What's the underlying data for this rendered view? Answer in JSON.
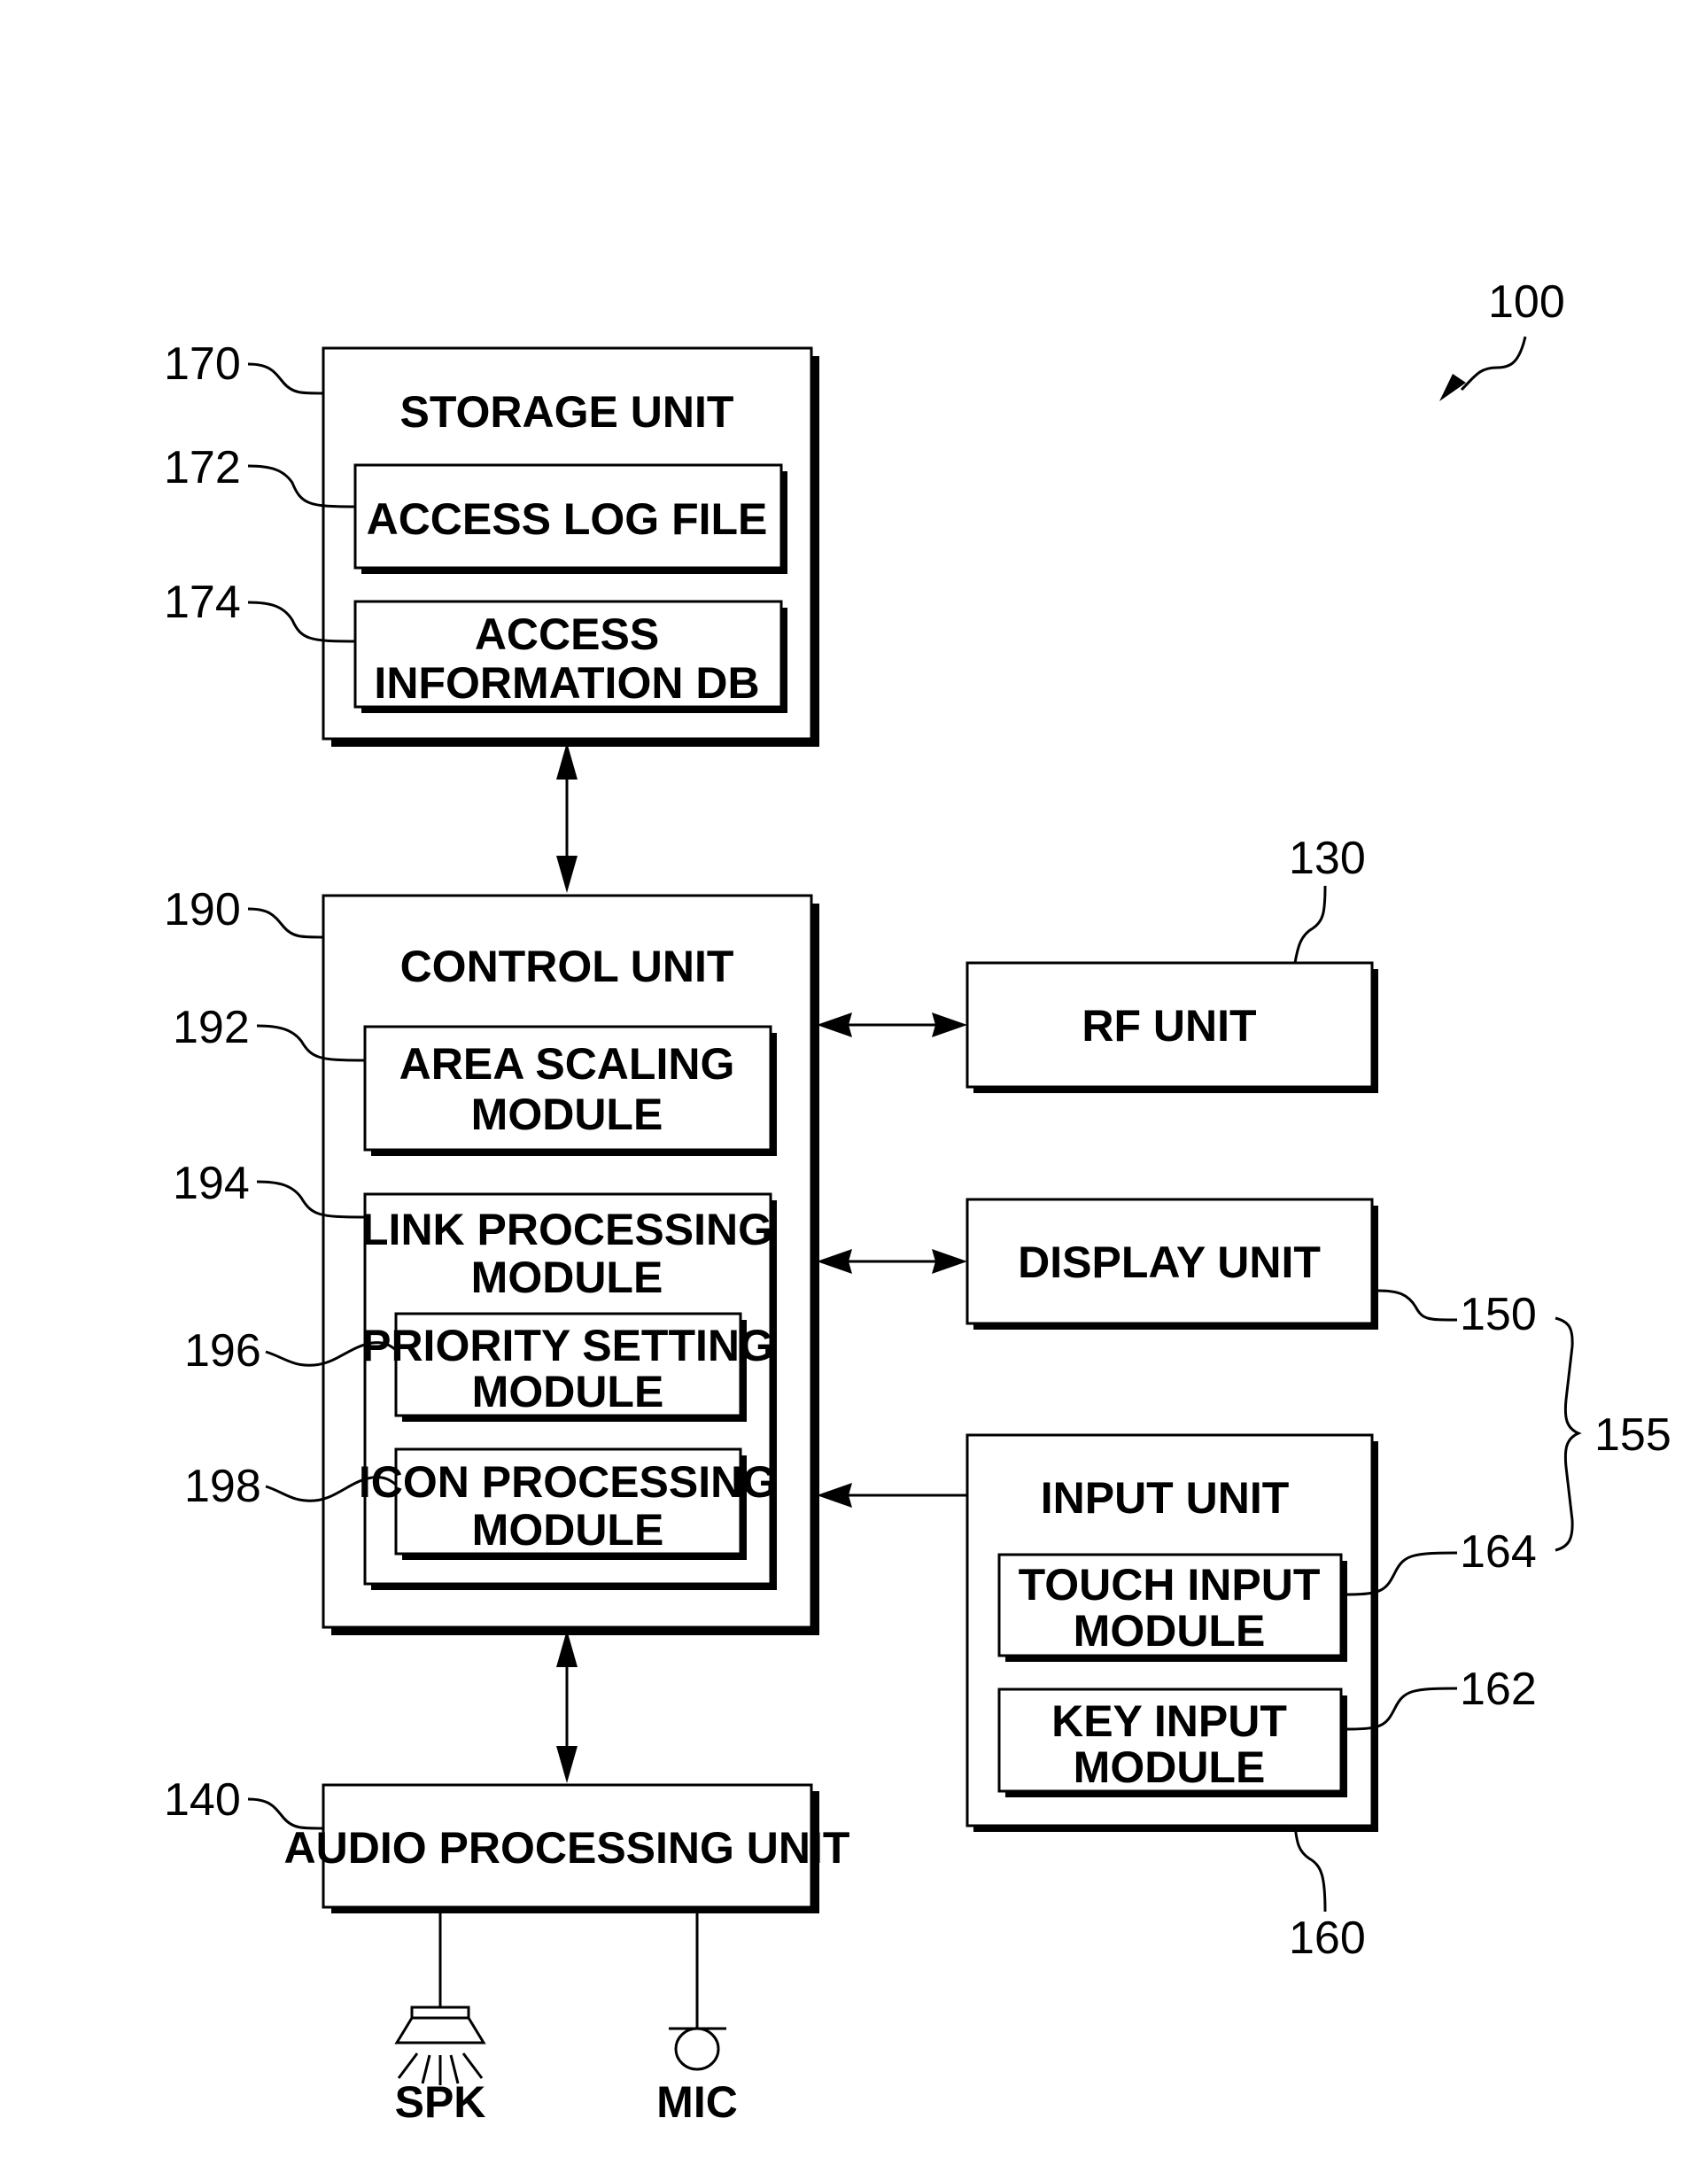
{
  "figure_ref": "100",
  "blocks": {
    "storage_unit": {
      "ref": "170",
      "title": "STORAGE UNIT",
      "children": {
        "access_log_file": {
          "ref": "172",
          "lines": [
            "ACCESS LOG FILE"
          ]
        },
        "access_information_db": {
          "ref": "174",
          "lines": [
            "ACCESS",
            "INFORMATION DB"
          ]
        }
      }
    },
    "control_unit": {
      "ref": "190",
      "title": "CONTROL UNIT",
      "children": {
        "area_scaling_module": {
          "ref": "192",
          "lines": [
            "AREA SCALING",
            "MODULE"
          ]
        },
        "link_processing_module": {
          "ref": "194",
          "lines": [
            "LINK PROCESSING",
            "MODULE"
          ],
          "children": {
            "priority_setting_module": {
              "ref": "196",
              "lines": [
                "PRIORITY SETTING",
                "MODULE"
              ]
            },
            "icon_processing_module": {
              "ref": "198",
              "lines": [
                "ICON PROCESSING",
                "MODULE"
              ]
            }
          }
        }
      }
    },
    "rf_unit": {
      "ref": "130",
      "lines": [
        "RF UNIT"
      ]
    },
    "display_unit": {
      "ref": "150",
      "lines": [
        "DISPLAY UNIT"
      ]
    },
    "input_unit": {
      "ref": "160",
      "title": "INPUT UNIT",
      "children": {
        "touch_input_module": {
          "ref": "164",
          "lines": [
            "TOUCH INPUT",
            "MODULE"
          ]
        },
        "key_input_module": {
          "ref": "162",
          "lines": [
            "KEY INPUT",
            "MODULE"
          ]
        }
      }
    },
    "audio_processing_unit": {
      "ref": "140",
      "lines": [
        "AUDIO PROCESSING UNIT"
      ]
    }
  },
  "group_brace": {
    "ref": "155",
    "groups": [
      "150",
      "164"
    ]
  },
  "peripherals": {
    "speaker": "SPK",
    "microphone": "MIC"
  },
  "connections": [
    {
      "from": "storage_unit",
      "to": "control_unit",
      "direction": "bidirectional"
    },
    {
      "from": "control_unit",
      "to": "rf_unit",
      "direction": "bidirectional"
    },
    {
      "from": "control_unit",
      "to": "display_unit",
      "direction": "bidirectional"
    },
    {
      "from": "input_unit",
      "to": "control_unit",
      "direction": "unidirectional"
    },
    {
      "from": "control_unit",
      "to": "audio_processing_unit",
      "direction": "bidirectional"
    },
    {
      "from": "audio_processing_unit",
      "to": "speaker",
      "direction": "line"
    },
    {
      "from": "audio_processing_unit",
      "to": "microphone",
      "direction": "line"
    }
  ]
}
